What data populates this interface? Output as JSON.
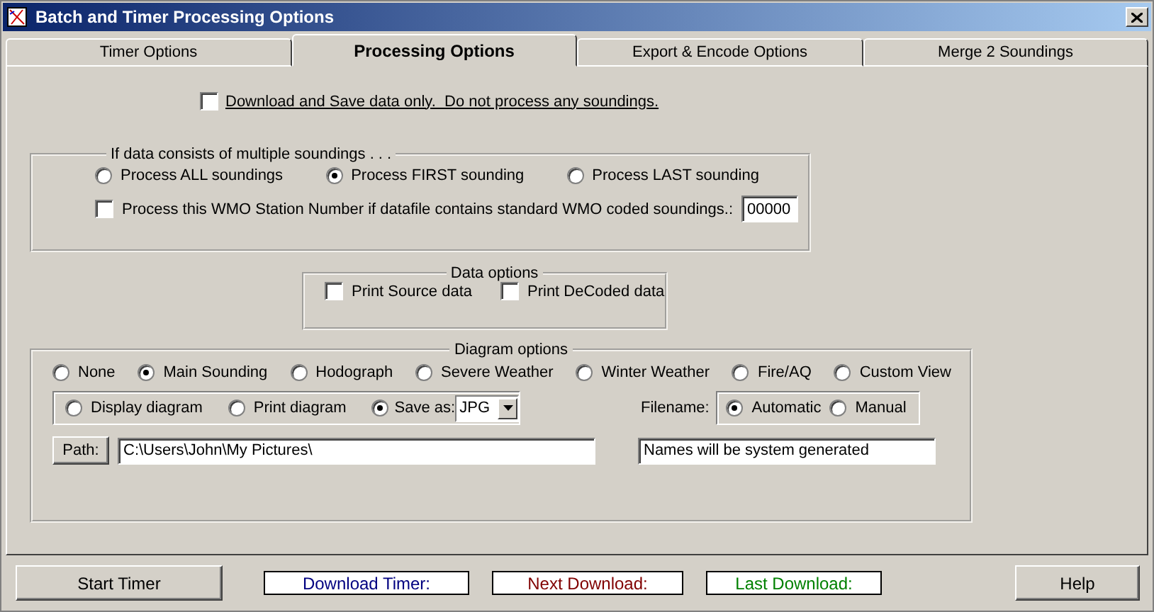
{
  "window": {
    "title": "Batch and Timer Processing Options"
  },
  "tabs": [
    {
      "label": "Timer Options",
      "selected": false
    },
    {
      "label": "Processing Options",
      "selected": true
    },
    {
      "label": "Export & Encode Options",
      "selected": false
    },
    {
      "label": "Merge 2 Soundings",
      "selected": false
    }
  ],
  "download_only": {
    "label": "Download and Save data only.  Do not process any soundings.",
    "checked": false
  },
  "multiple_soundings": {
    "legend": "If data consists of multiple soundings . . .",
    "options": [
      {
        "label": "Process ALL soundings",
        "selected": false
      },
      {
        "label": "Process FIRST sounding",
        "selected": true
      },
      {
        "label": "Process LAST sounding",
        "selected": false
      }
    ],
    "wmo": {
      "label": "Process this WMO Station Number if datafile contains standard WMO coded soundings.:",
      "checked": false,
      "value": "00000"
    }
  },
  "data_options": {
    "legend": "Data options",
    "items": [
      {
        "label": "Print Source data",
        "checked": false
      },
      {
        "label": "Print DeCoded data",
        "checked": false
      }
    ]
  },
  "diagram_options": {
    "legend": "Diagram options",
    "types": [
      {
        "label": "None",
        "selected": false
      },
      {
        "label": "Main Sounding",
        "selected": true
      },
      {
        "label": "Hodograph",
        "selected": false
      },
      {
        "label": "Severe Weather",
        "selected": false
      },
      {
        "label": "Winter Weather",
        "selected": false
      },
      {
        "label": "Fire/AQ",
        "selected": false
      },
      {
        "label": "Custom View",
        "selected": false
      }
    ],
    "outputs": [
      {
        "label": "Display diagram",
        "selected": false
      },
      {
        "label": "Print diagram",
        "selected": false
      },
      {
        "label": "Save as:",
        "selected": true
      }
    ],
    "format": "JPG",
    "filename_label": "Filename:",
    "filename_modes": [
      {
        "label": "Automatic",
        "selected": true
      },
      {
        "label": "Manual",
        "selected": false
      }
    ],
    "path_button": "Path:",
    "path_value": "C:\\Users\\John\\My Pictures\\",
    "filename_value": "Names will be system generated"
  },
  "footer": {
    "start_button": "Start Timer",
    "status": [
      {
        "label": "Download Timer:",
        "color": "#000080"
      },
      {
        "label": "Next Download:",
        "color": "#800000"
      },
      {
        "label": "Last Download:",
        "color": "#008000"
      }
    ],
    "help_button": "Help"
  }
}
